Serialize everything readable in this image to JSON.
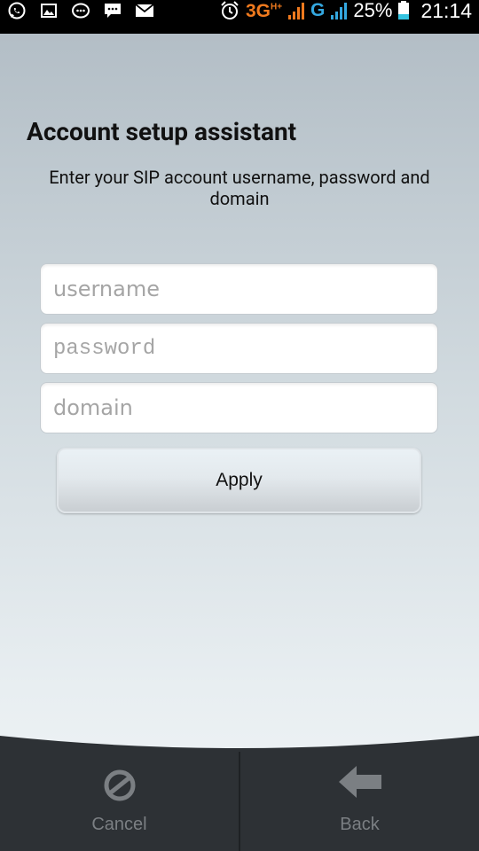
{
  "status_bar": {
    "network_3g": "3G",
    "network_h": "H+",
    "network_g": "G",
    "battery": "25%",
    "time": "21:14",
    "icons": [
      "whatsapp-icon",
      "gallery-icon",
      "chat-icon",
      "message-icon",
      "mail-icon",
      "alarm-icon",
      "signal-icon",
      "battery-icon"
    ]
  },
  "main": {
    "title": "Account setup assistant",
    "subtitle": "Enter your SIP account username, password and domain"
  },
  "form": {
    "username_placeholder": "username",
    "password_placeholder": "password",
    "domain_placeholder": "domain",
    "apply_label": "Apply"
  },
  "bottom_bar": {
    "cancel_label": "Cancel",
    "back_label": "Back",
    "icons": [
      "cancel-icon",
      "back-arrow-icon"
    ]
  },
  "colors": {
    "bar_bg": "#2d3135",
    "label_gray": "#7b7f83",
    "accent_orange": "#f07a1e",
    "accent_blue": "#34a8e0"
  }
}
